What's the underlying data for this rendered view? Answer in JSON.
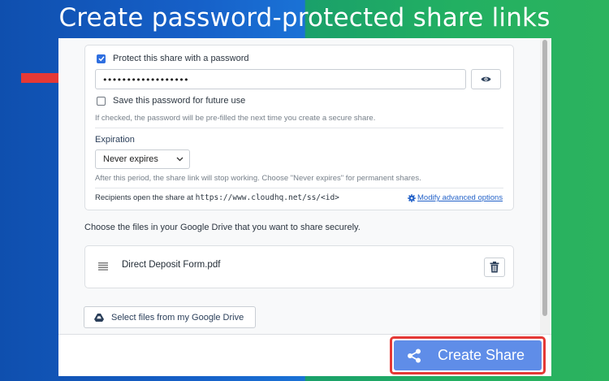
{
  "headline": "Create password-protected share links",
  "password_section": {
    "protect_label": "Protect this share with a password",
    "protect_checked": true,
    "password_value": "••••••••••••••••••",
    "toggle_icon": "eye-icon",
    "save_label": "Save this password for future use",
    "save_checked": false,
    "save_helper": "If checked, the password will be pre-filled the next time you create a secure share."
  },
  "expiration": {
    "label": "Expiration",
    "selected": "Never expires",
    "helper": "After this period, the share link will stop working. Choose \"Never expires\" for permanent shares."
  },
  "recipients": {
    "prefix": "Recipients open the share at",
    "url": "https://www.cloudhq.net/ss/<id>",
    "advanced_link": "Modify advanced options"
  },
  "files": {
    "instruction": "Choose the files in your Google Drive that you want to share securely.",
    "items": [
      {
        "name": "Direct Deposit Form.pdf"
      }
    ],
    "select_button": "Select files from my Google Drive"
  },
  "create_button": "Create Share",
  "colors": {
    "accent": "#2f6fe0",
    "primary_button": "#5f8de8",
    "highlight": "#e53935",
    "link": "#2563c9"
  }
}
